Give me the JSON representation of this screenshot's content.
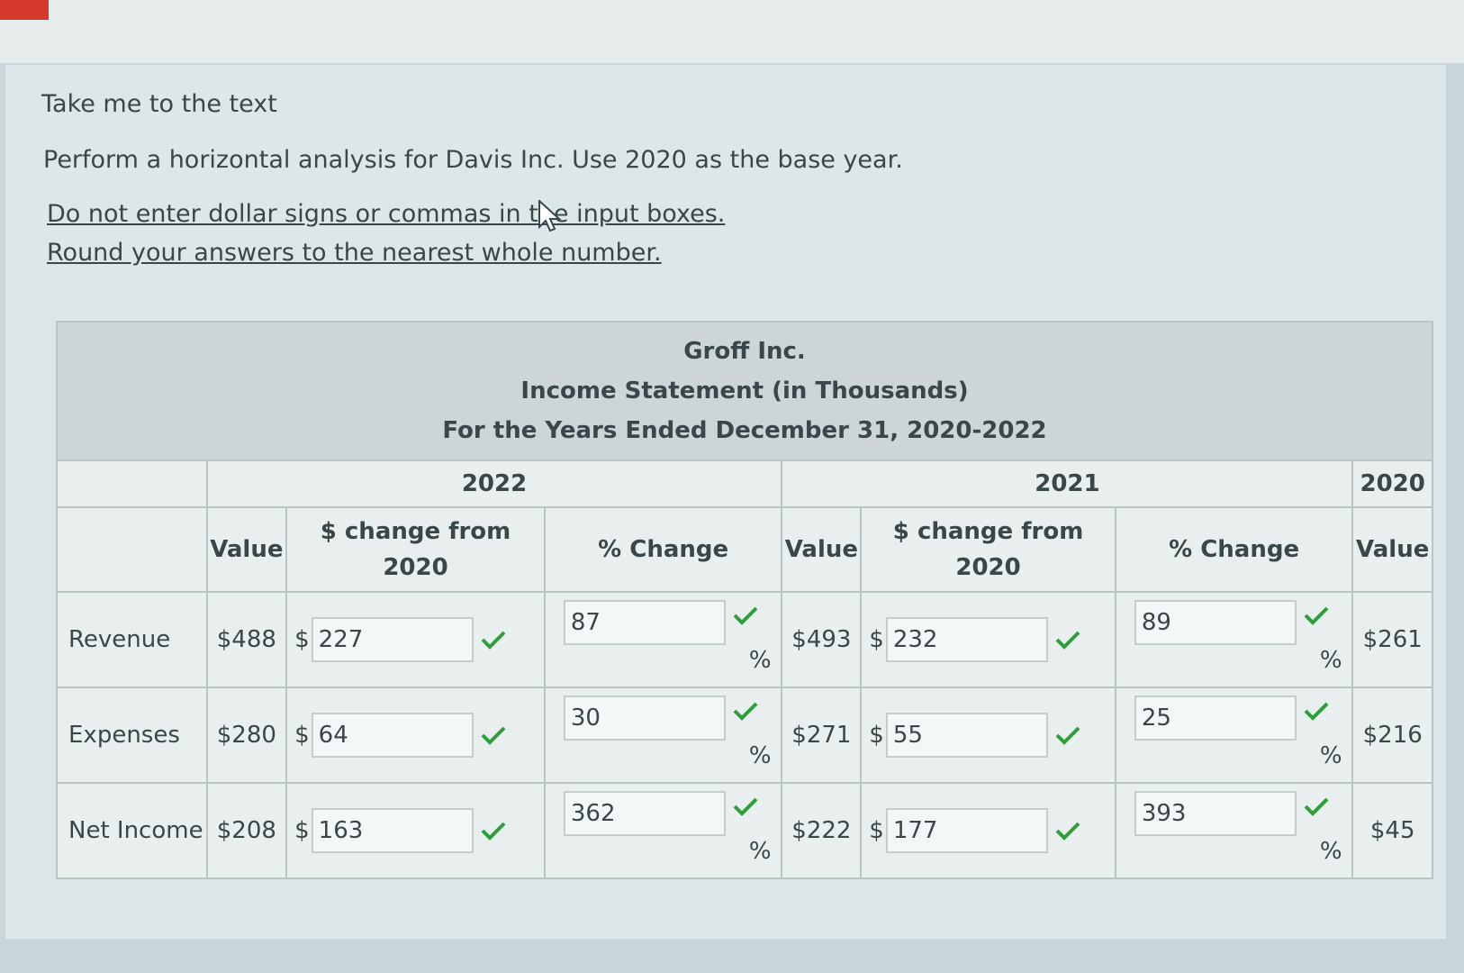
{
  "instructions": {
    "link": "Take me to the text",
    "task": "Perform a horizontal analysis for Davis Inc. Use 2020 as the base year.",
    "note1": "Do not enter dollar signs or commas in the input boxes.",
    "note2": "Round your answers to the nearest whole number."
  },
  "statement": {
    "company": "Groff Inc.",
    "title": "Income Statement (in Thousands)",
    "period": "For the Years Ended December 31, 2020-2022"
  },
  "years": {
    "y2022": "2022",
    "y2021": "2021",
    "y2020": "2020"
  },
  "columns": {
    "value": "Value",
    "dollar_change": "$ change from 2020",
    "pct_change": "% Change"
  },
  "symbols": {
    "dollar": "$",
    "percent": "%"
  },
  "rows": [
    {
      "label": "Revenue",
      "v2022": "$488",
      "d2022": "227",
      "p2022": "87",
      "v2021": "$493",
      "d2021": "232",
      "p2021": "89",
      "v2020": "$261"
    },
    {
      "label": "Expenses",
      "v2022": "$280",
      "d2022": "64",
      "p2022": "30",
      "v2021": "$271",
      "d2021": "55",
      "p2021": "25",
      "v2020": "$216"
    },
    {
      "label": "Net Income",
      "v2022": "$208",
      "d2022": "163",
      "p2022": "362",
      "v2021": "$222",
      "d2021": "177",
      "p2021": "393",
      "v2020": "$45"
    }
  ],
  "colors": {
    "check": "#2e9e3a",
    "header_bg": "#cdd5d6"
  }
}
